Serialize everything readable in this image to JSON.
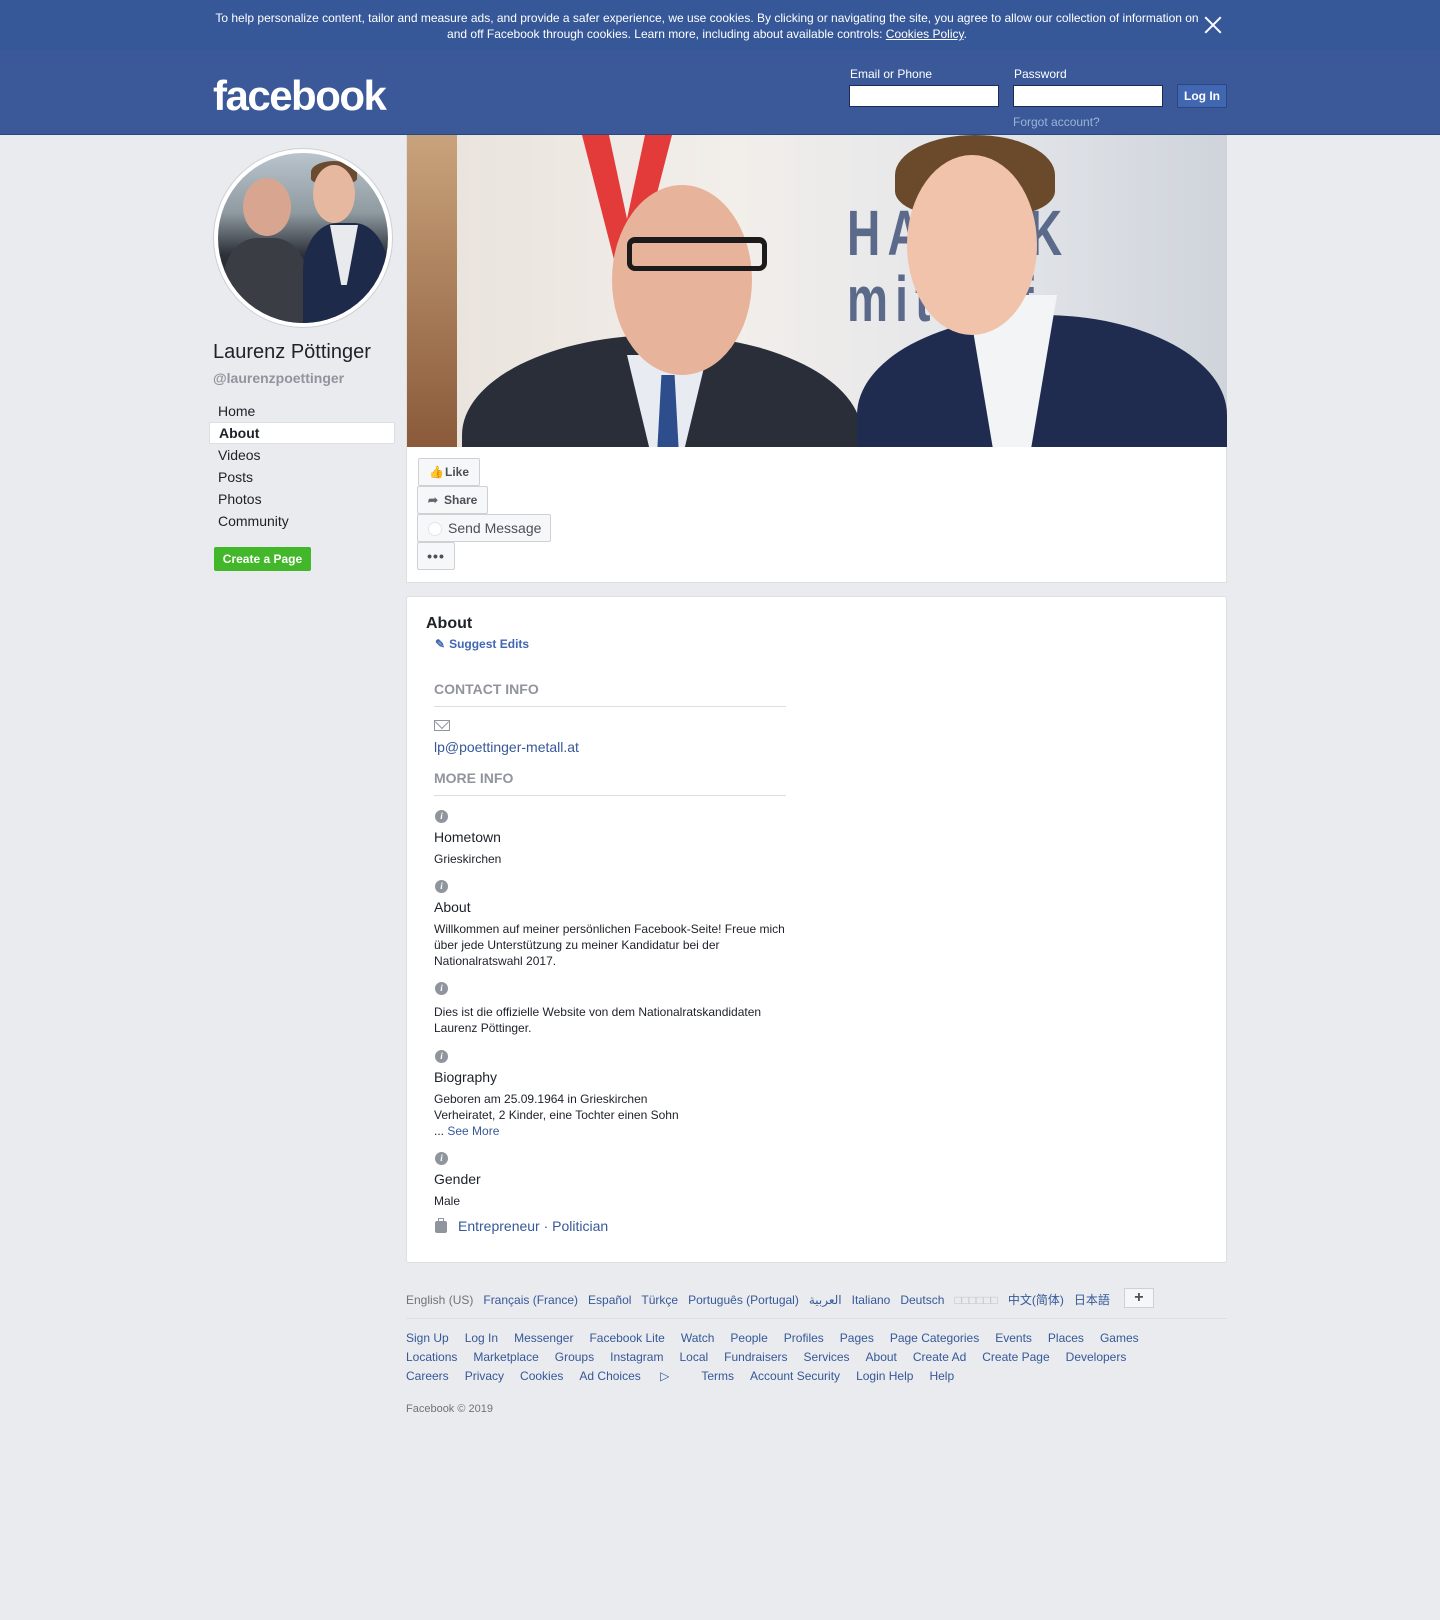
{
  "cookie_banner": {
    "text": "To help personalize content, tailor and measure ads, and provide a safer experience, we use cookies. By clicking or navigating the site, you agree to allow our collection of information on and off Facebook through cookies. Learn more, including about available controls: ",
    "link": "Cookies Policy",
    "end": ".",
    "close_icon": "close-icon"
  },
  "header": {
    "logo": "facebook",
    "email_label": "Email or Phone",
    "email_value": "",
    "password_label": "Password",
    "password_value": "",
    "login_button": "Log In",
    "forgot": "Forgot account?"
  },
  "profile": {
    "name": "Laurenz Pöttinger",
    "handle": "@laurenzpoettinger"
  },
  "nav": {
    "items": [
      {
        "label": "Home",
        "active": false
      },
      {
        "label": "About",
        "active": true
      },
      {
        "label": "Videos",
        "active": false
      },
      {
        "label": "Posts",
        "active": false
      },
      {
        "label": "Photos",
        "active": false
      },
      {
        "label": "Community",
        "active": false
      }
    ],
    "create_page": "Create a Page"
  },
  "actions": {
    "like": "Like",
    "share": "Share",
    "send_message": "Send Message",
    "more": "•••"
  },
  "about": {
    "title": "About",
    "suggest_edits": "Suggest Edits",
    "contact_head": "CONTACT INFO",
    "email": "lp@poettinger-metall.at",
    "more_head": "MORE INFO",
    "hometown_label": "Hometown",
    "hometown_value": "Grieskirchen",
    "about_label": "About",
    "about_value": "Willkommen auf meiner persönlichen Facebook-Seite! Freue mich über jede Unterstützung zu meiner Kandidatur bei der Nationalratswahl 2017.",
    "website_value": "Dies ist die offizielle Website von dem Nationalratskandidaten Laurenz Pöttinger.",
    "bio_label": "Biography",
    "bio_line1": "Geboren am 25.09.1964 in Grieskirchen",
    "bio_line2": "Verheiratet, 2 Kinder, eine Tochter einen Sohn",
    "bio_ellipsis": "... ",
    "bio_see_more": "See More",
    "gender_label": "Gender",
    "gender_value": "Male",
    "categories": "Entrepreneur · Politician"
  },
  "footer": {
    "languages": [
      "English (US)",
      "Français (France)",
      "Español",
      "Türkçe",
      "Português (Portugal)",
      "العربية",
      "Italiano",
      "Deutsch",
      "□□□□□□",
      "中文(简体)",
      "日本語"
    ],
    "lang_more": "+",
    "links": [
      "Sign Up",
      "Log In",
      "Messenger",
      "Facebook Lite",
      "Watch",
      "People",
      "Profiles",
      "Pages",
      "Page Categories",
      "Events",
      "Places",
      "Games",
      "Locations",
      "Marketplace",
      "Groups",
      "Instagram",
      "Local",
      "Fundraisers",
      "Services",
      "About",
      "Create Ad",
      "Create Page",
      "Developers",
      "Careers",
      "Privacy",
      "Cookies",
      "Ad Choices",
      "Terms",
      "Account Security",
      "Login Help",
      "Help"
    ],
    "copyright": "Facebook © 2019"
  }
}
